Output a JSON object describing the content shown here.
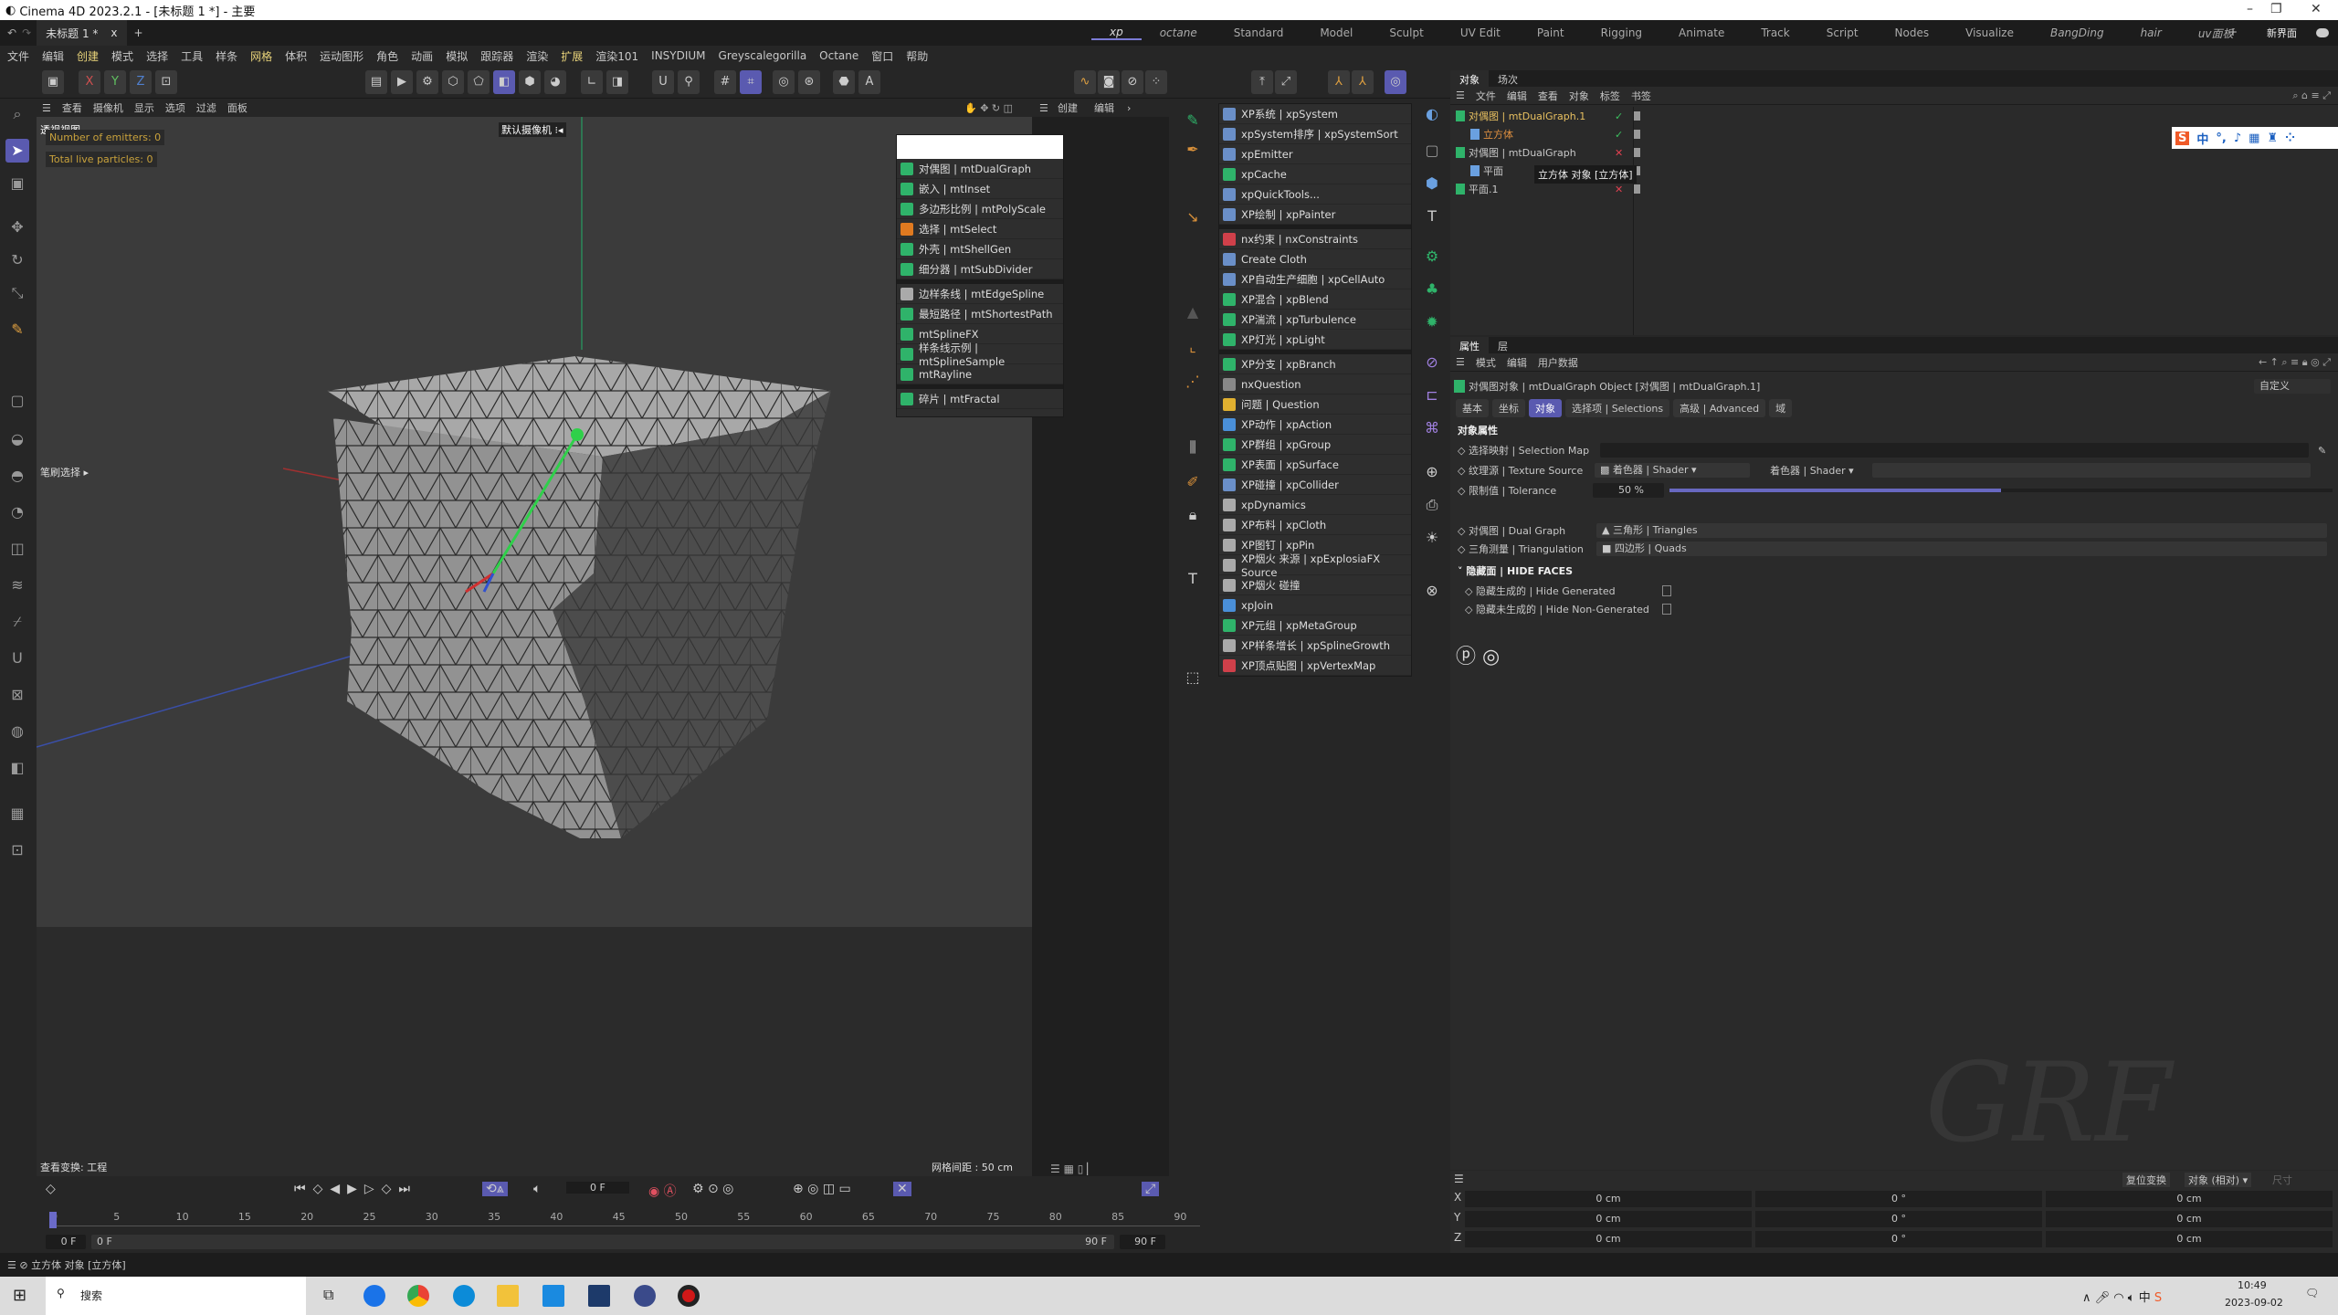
{
  "window": {
    "title": "Cinema 4D 2023.2.1 - [未标题 1 *] - 主要",
    "controls": [
      "–",
      "❐",
      "✕"
    ]
  },
  "tabs": {
    "document": "未标题 1 *",
    "close": "x",
    "add": "+"
  },
  "layouts": {
    "items": [
      "xp",
      "octane",
      "Standard",
      "Model",
      "Sculpt",
      "UV Edit",
      "Paint",
      "Rigging",
      "Animate",
      "Track",
      "Script",
      "Nodes",
      "Visualize",
      "BangDing",
      "hair",
      "uv面板"
    ],
    "active": "xp",
    "add": "+",
    "new_layout": "新界面"
  },
  "menubar": [
    "文件",
    "编辑",
    "创建",
    "模式",
    "选择",
    "工具",
    "样条",
    "网格",
    "体积",
    "运动图形",
    "角色",
    "动画",
    "模拟",
    "跟踪器",
    "渲染",
    "扩展",
    "渲染101",
    "INSYDIUM",
    "Greyscalegorilla",
    "Octane",
    "窗口",
    "帮助"
  ],
  "viewport": {
    "menu": [
      "查看",
      "摄像机",
      "显示",
      "选项",
      "过滤",
      "面板"
    ],
    "right_menu": [
      "创建",
      "编辑"
    ],
    "name": "透视视图",
    "camera": "默认摄像机 ⁝◂",
    "emitters": "Number of emitters: 0",
    "particles": "Total live particles: 0",
    "brush_label": "笔刷选择 ▸",
    "transform": "查看变换: 工程",
    "grid": "网格间距 : 50 cm"
  },
  "mt_menu": {
    "items": [
      {
        "label": "对偶图 | mtDualGraph",
        "color": "#2fb36a"
      },
      {
        "label": "嵌入 | mtInset",
        "color": "#2fb36a"
      },
      {
        "label": "多边形比例 | mtPolyScale",
        "color": "#2fb36a"
      },
      {
        "label": "选择 | mtSelect",
        "color": "#e07a20"
      },
      {
        "label": "外壳 | mtShellGen",
        "color": "#2fb36a"
      },
      {
        "label": "细分器 | mtSubDivider",
        "color": "#2fb36a"
      },
      {
        "label": "边样条线 | mtEdgeSpline",
        "color": "#aaaaaa",
        "sep": true
      },
      {
        "label": "最短路径 | mtShortestPath",
        "color": "#2fb36a"
      },
      {
        "label": "mtSplineFX",
        "color": "#2fb36a"
      },
      {
        "label": "样条线示例 | mtSplineSample",
        "color": "#2fb36a"
      },
      {
        "label": "mtRayline",
        "color": "#2fb36a"
      },
      {
        "label": "碎片 | mtFractal",
        "color": "#2fb36a",
        "sep": true
      }
    ]
  },
  "xp_menu": {
    "items": [
      {
        "label": "XP系统 | xpSystem",
        "color": "#6a8fc8"
      },
      {
        "label": "xpSystem排序 | xpSystemSort",
        "color": "#6a8fc8"
      },
      {
        "label": "xpEmitter",
        "color": "#6a8fc8"
      },
      {
        "label": "xpCache",
        "color": "#2fb36a"
      },
      {
        "label": "xpQuickTools...",
        "color": "#6a8fc8"
      },
      {
        "label": "XP绘制 | xpPainter",
        "color": "#6a8fc8"
      },
      {
        "label": "nx约束 | nxConstraints",
        "color": "#d0404a",
        "sep": true
      },
      {
        "label": "Create Cloth",
        "color": "#6a8fc8"
      },
      {
        "label": "XP自动生产细胞 | xpCellAuto",
        "color": "#6a8fc8"
      },
      {
        "label": "XP混合 | xpBlend",
        "color": "#2fb36a"
      },
      {
        "label": "XP湍流 | xpTurbulence",
        "color": "#2fb36a"
      },
      {
        "label": "XP灯光 | xpLight",
        "color": "#2fb36a"
      },
      {
        "label": "XP分支 | xpBranch",
        "color": "#2fb36a",
        "sep": true
      },
      {
        "label": "nxQuestion",
        "color": "#888888"
      },
      {
        "label": "问题 | Question",
        "color": "#e0b030"
      },
      {
        "label": "XP动作 | xpAction",
        "color": "#4a8fd8"
      },
      {
        "label": "XP群组 | xpGroup",
        "color": "#2fb36a"
      },
      {
        "label": "XP表面 | xpSurface",
        "color": "#2fb36a"
      },
      {
        "label": "XP碰撞 | xpCollider",
        "color": "#6a8fc8"
      },
      {
        "label": "xpDynamics",
        "color": "#aaaaaa"
      },
      {
        "label": "XP布料 | xpCloth",
        "color": "#aaaaaa"
      },
      {
        "label": "XP图钉 | xpPin",
        "color": "#aaaaaa"
      },
      {
        "label": "XP烟火 来源 | xpExplosiaFX Source",
        "color": "#aaaaaa"
      },
      {
        "label": "XP烟火 碰撞",
        "color": "#aaaaaa"
      },
      {
        "label": "xpJoin",
        "color": "#4a8fd8"
      },
      {
        "label": "XP元组 | xpMetaGroup",
        "color": "#2fb36a"
      },
      {
        "label": "XP样条增长 | xpSplineGrowth",
        "color": "#aaaaaa"
      },
      {
        "label": "XP顶点贴图 | xpVertexMap",
        "color": "#d0404a"
      }
    ]
  },
  "object_manager": {
    "tabs": [
      "对象",
      "场次"
    ],
    "menu": [
      "文件",
      "编辑",
      "查看",
      "对象",
      "标签",
      "书签"
    ],
    "rows": [
      {
        "name": "对偶图 | mtDualGraph.1",
        "indent": 0,
        "color": "#e8c060",
        "status": "✓"
      },
      {
        "name": "立方体",
        "indent": 1,
        "color": "#e09040",
        "status": "✓"
      },
      {
        "name": "对偶图 | mtDualGraph",
        "indent": 0,
        "color": "#c8c8c8",
        "status": "✕"
      },
      {
        "name": "平面",
        "indent": 1,
        "color": "#c8c8c8",
        "status": ""
      },
      {
        "name": "平面.1",
        "indent": 0,
        "color": "#c8c8c8",
        "status": "✕"
      }
    ],
    "tooltip": "立方体 对象 [立方体]",
    "ime": [
      "中",
      "°,",
      "🎤",
      "⌨",
      "👕",
      "⁘"
    ]
  },
  "attributes": {
    "tabs": [
      "属性",
      "层"
    ],
    "menu": [
      "模式",
      "编辑",
      "用户数据"
    ],
    "object_title": "对偶图对象 | mtDualGraph Object [对偶图 | mtDualGraph.1]",
    "preset": "自定义",
    "subtabs": [
      "基本",
      "坐标",
      "对象",
      "选择项 | Selections",
      "高级 | Advanced",
      "域"
    ],
    "active_subtab": "对象",
    "section": "对象属性",
    "selection_map": "选择映射 | Selection Map",
    "texture_source": "纹理源 | Texture Source",
    "texture_value": "着色器 | Shader",
    "shader_label": "着色器 | Shader",
    "tolerance": "限制值 | Tolerance",
    "tolerance_value": "50 %",
    "tolerance_fraction": 0.5,
    "dual_graph": "对偶图 | Dual Graph",
    "dual_graph_value": "三角形 | Triangles",
    "triangulation": "三角测量 | Triangulation",
    "triangulation_value": "四边形 | Quads",
    "hide_faces": "隐藏面 | HIDE FACES",
    "hide_generated": "隐藏生成的 | Hide Generated",
    "hide_non_generated": "隐藏未生成的 | Hide Non-Generated"
  },
  "coordinates": {
    "reset": "复位变换",
    "mode": "对象 (相对)",
    "size": "尺寸",
    "rows": [
      {
        "axis": "X",
        "pos": "0 cm",
        "rot": "0 °",
        "scale": "0 cm"
      },
      {
        "axis": "Y",
        "pos": "0 cm",
        "rot": "0 °",
        "scale": "0 cm"
      },
      {
        "axis": "Z",
        "pos": "0 cm",
        "rot": "0 °",
        "scale": "0 cm"
      }
    ]
  },
  "timeline": {
    "current_frame": "0 F",
    "ticks": [
      "0",
      "5",
      "10",
      "15",
      "20",
      "25",
      "30",
      "35",
      "40",
      "45",
      "50",
      "55",
      "60",
      "65",
      "70",
      "75",
      "80",
      "85",
      "90"
    ],
    "start": "0 F",
    "range_start": "0 F",
    "range_end": "90 F",
    "end": "90 F"
  },
  "status": "立方体 对象 [立方体]",
  "taskbar": {
    "search": "搜索",
    "time": "10:49",
    "date": "2023-09-02",
    "ime": "中"
  },
  "watermark": "GRF",
  "accent": "#5a5ab0"
}
